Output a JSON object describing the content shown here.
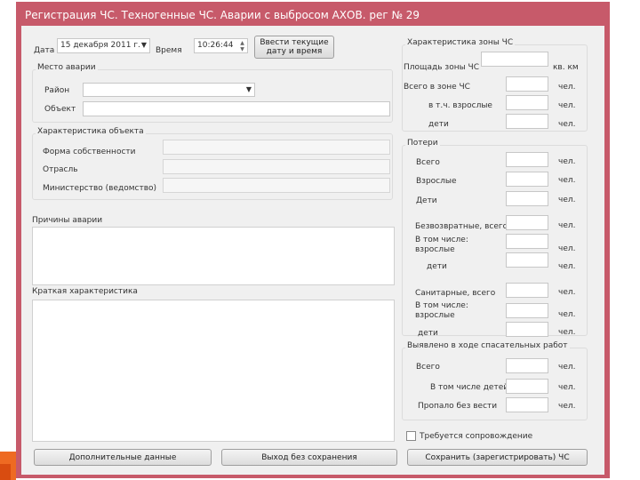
{
  "window": {
    "title": "Регистрация ЧС. Техногенные ЧС. Аварии с выбросом АХОВ. рег № 29"
  },
  "top": {
    "date_label": "Дата",
    "date_value": "15 декабря 2011 г.",
    "time_label": "Время",
    "time_value": "10:26:44",
    "set_current_button": "Ввести текущие дату и время"
  },
  "accident_place": {
    "title": "Место аварии",
    "district_label": "Район",
    "district_value": "",
    "object_label": "Объект",
    "object_value": ""
  },
  "object_info": {
    "title": "Характеристика объекта",
    "ownership_label": "Форма собственности",
    "industry_label": "Отрасль",
    "ministry_label": "Министерство (ведомство)",
    "ownership_value": "",
    "industry_value": "",
    "ministry_value": ""
  },
  "causes": {
    "title": "Причины аварии",
    "value": ""
  },
  "short_desc": {
    "title": "Краткая характеристика",
    "value": ""
  },
  "zone": {
    "title": "Характеристика зоны ЧС",
    "area_label": "Площадь зоны ЧС",
    "area_unit": "кв. км",
    "total_label": "Всего в зоне ЧС",
    "adults_label": "в т.ч. взрослые",
    "children_label": "дети",
    "unit": "чел."
  },
  "losses": {
    "title": "Потери",
    "total_label": "Всего",
    "adults_label": "Взрослые",
    "children_label": "Дети",
    "irrev_label": "Безвозвратные, всего",
    "incl_adults_label": "В том числе: взрослые",
    "children2_label": "дети",
    "sanitary_label": "Санитарные, всего",
    "incl_adults2_label": "В том числе: взрослые",
    "children3_label": "дети",
    "unit": "чел."
  },
  "rescue": {
    "title": "Выявлено в ходе спасательных работ",
    "total_label": "Всего",
    "incl_children_label": "В том числе детей",
    "missing_label": "Пропало без вести",
    "unit": "чел."
  },
  "escort": {
    "label": "Требуется сопровождение",
    "checked": false
  },
  "buttons": {
    "additional": "Дополнительные данные",
    "exit_no_save": "Выход без сохранения",
    "save": "Сохранить (зарегистрировать) ЧС"
  },
  "colors": {
    "titlebar": "#c75a6a",
    "client_bg": "#f0f0f0",
    "accent_orange": "#ee6a22"
  },
  "icons": {
    "dropdown": "chevron-down-icon",
    "spinner": "spinner-arrows-icon",
    "checkbox": "checkbox-icon"
  }
}
